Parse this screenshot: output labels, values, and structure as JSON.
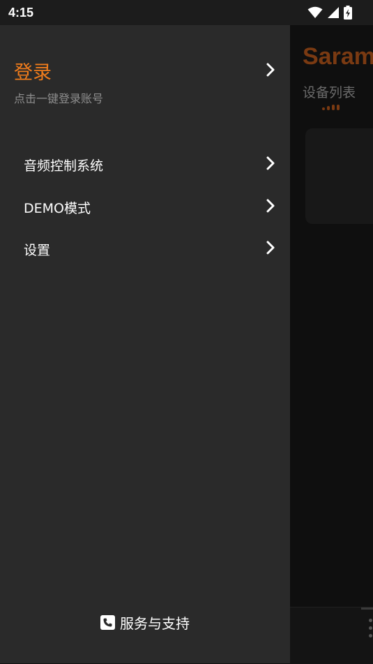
{
  "status_bar": {
    "time": "4:15"
  },
  "drawer": {
    "login": {
      "title": "登录",
      "subtitle": "点击一键登录账号"
    },
    "menu": [
      {
        "label": "音频控制系统"
      },
      {
        "label": "DEMO模式"
      },
      {
        "label": "设置"
      }
    ],
    "footer": {
      "label": "服务与支持",
      "icon": "phone-icon"
    }
  },
  "background_app": {
    "title": "Saram",
    "subtitle": "设备列表"
  },
  "colors": {
    "accent": "#f07c1c",
    "drawer_bg": "#2a2a2a",
    "app_bg": "#111111"
  }
}
